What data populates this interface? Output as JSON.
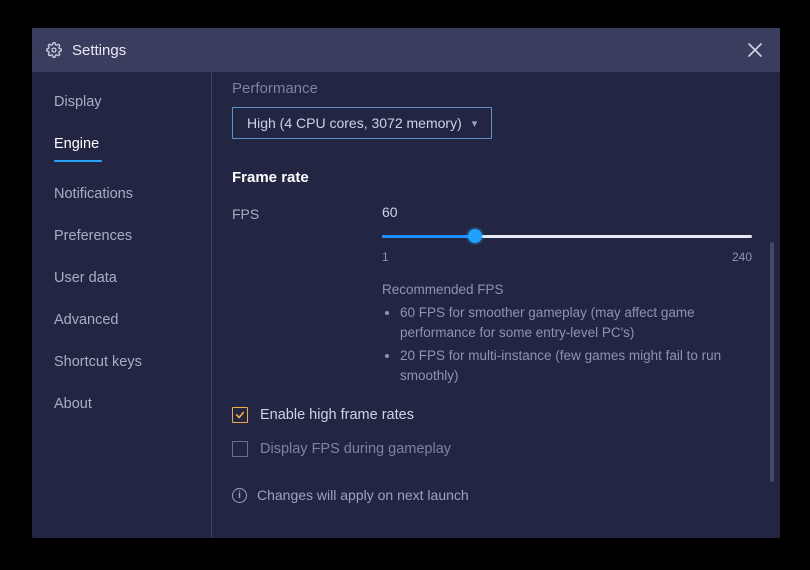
{
  "title": "Settings",
  "sidebar": {
    "items": [
      {
        "label": "Display"
      },
      {
        "label": "Engine"
      },
      {
        "label": "Notifications"
      },
      {
        "label": "Preferences"
      },
      {
        "label": "User data"
      },
      {
        "label": "Advanced"
      },
      {
        "label": "Shortcut keys"
      },
      {
        "label": "About"
      }
    ],
    "active_index": 1
  },
  "content": {
    "performance": {
      "title": "Performance",
      "selected": "High (4 CPU cores, 3072 memory)"
    },
    "framerate": {
      "title": "Frame rate",
      "label": "FPS",
      "value": "60",
      "min": "1",
      "max": "240",
      "percent": 25,
      "recommended_title": "Recommended FPS",
      "bullets": [
        "60 FPS for smoother gameplay (may affect game performance for some entry-level PC's)",
        "20 FPS for multi-instance (few games might fail to run smoothly)"
      ],
      "enable_high_label": "Enable high frame rates",
      "enable_high_checked": true,
      "display_fps_label": "Display FPS during gameplay",
      "display_fps_checked": false
    },
    "notice": "Changes will apply on next launch"
  }
}
